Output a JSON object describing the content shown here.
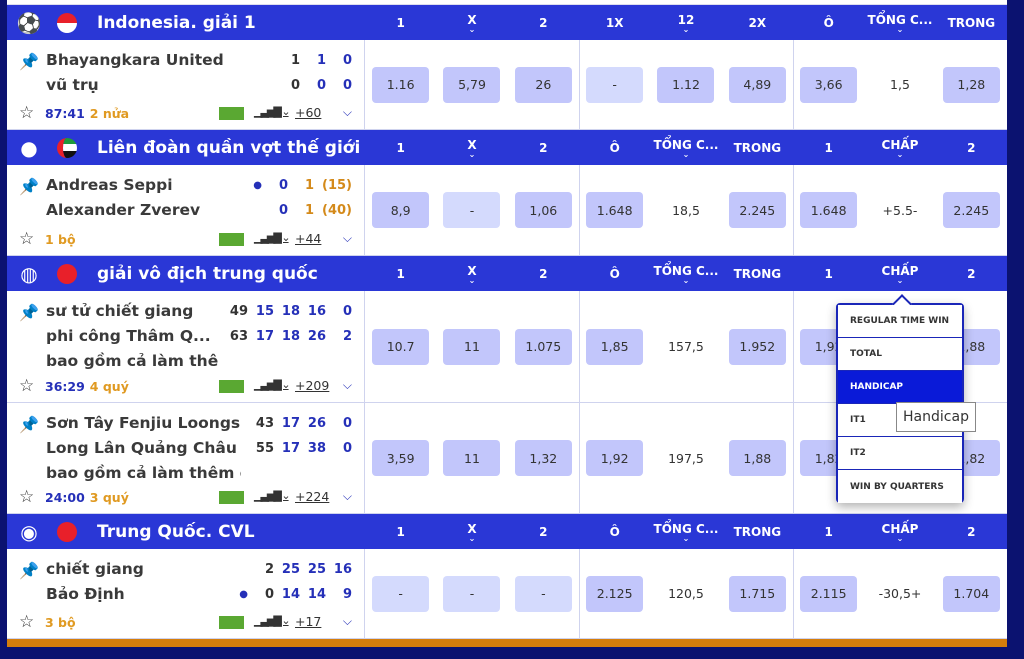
{
  "colors": {
    "header": "#2a37d6",
    "odd_bg": "#c2c6fb",
    "empty_bg": "#d4dafd",
    "accent_blue": "#2530b8",
    "period_orange": "#e09a22",
    "dropdown_selected": "#0a1ad8",
    "bottom_bar": "#d47d0c"
  },
  "leagues": [
    {
      "sport_icon": "soccer-ball-icon",
      "flag": "indonesia",
      "name": "Indonesia. giải 1",
      "columns": [
        {
          "label": "1"
        },
        {
          "label": "X",
          "chevron": true
        },
        {
          "label": "2"
        },
        {
          "label": "1X"
        },
        {
          "label": "12",
          "chevron": true
        },
        {
          "label": "2X"
        },
        {
          "label": "Ô"
        },
        {
          "label": "TỔNG C...",
          "chevron": true
        },
        {
          "label": "TRONG"
        }
      ],
      "matches": [
        {
          "teams": [
            "Bhayangkara United",
            "vũ trụ"
          ],
          "scores": [
            [
              "1",
              "1",
              "0"
            ],
            [
              "0",
              "0",
              "0"
            ]
          ],
          "score_kinds": [
            "total",
            "period",
            "period"
          ],
          "time": "87:41",
          "period": "2 nửa",
          "more": "+60",
          "height": 90,
          "odds": [
            {
              "v": "1.16"
            },
            {
              "v": "5,79"
            },
            {
              "v": "26"
            },
            {
              "v": "-",
              "empty": true
            },
            {
              "v": "1.12"
            },
            {
              "v": "4,89"
            },
            {
              "v": "3,66"
            },
            {
              "v": "1,5",
              "plain": true
            },
            {
              "v": "1,28"
            }
          ]
        }
      ]
    },
    {
      "sport_icon": "tennis-ball-icon",
      "flag": "uae",
      "name": "Liên đoàn quần vợt thế giới",
      "columns": [
        {
          "label": "1"
        },
        {
          "label": "X",
          "chevron": true
        },
        {
          "label": "2"
        },
        {
          "label": "Ô"
        },
        {
          "label": "TỔNG C...",
          "chevron": true
        },
        {
          "label": "TRONG"
        },
        {
          "label": "1"
        },
        {
          "label": "CHẤP",
          "chevron": true
        },
        {
          "label": "2"
        }
      ],
      "matches": [
        {
          "teams": [
            "Andreas Seppi",
            "Alexander Zverev"
          ],
          "scores": [
            [
              "0",
              "1",
              "(15)"
            ],
            [
              "0",
              "1",
              "(40)"
            ]
          ],
          "score_kinds": [
            "period",
            "game",
            "game"
          ],
          "serve_row": 0,
          "serve_icon": "tennis-serve-icon",
          "time": "",
          "period": "1 bộ",
          "more": "+44",
          "height": 91,
          "odds": [
            {
              "v": "8,9"
            },
            {
              "v": "-",
              "empty": true
            },
            {
              "v": "1,06"
            },
            {
              "v": "1.648"
            },
            {
              "v": "18,5",
              "plain": true
            },
            {
              "v": "2.245"
            },
            {
              "v": "1.648"
            },
            {
              "v": "+5.5-",
              "plain": true
            },
            {
              "v": "2.245"
            }
          ]
        }
      ]
    },
    {
      "sport_icon": "basketball-icon",
      "flag": "china",
      "name": "giải vô địch trung quốc",
      "columns": [
        {
          "label": "1"
        },
        {
          "label": "X",
          "chevron": true
        },
        {
          "label": "2"
        },
        {
          "label": "Ô"
        },
        {
          "label": "TỔNG C...",
          "chevron": true
        },
        {
          "label": "TRONG"
        },
        {
          "label": "1"
        },
        {
          "label": "CHẤP",
          "chevron": true
        },
        {
          "label": "2"
        }
      ],
      "matches": [
        {
          "teams": [
            "sư tử chiết giang",
            "phi công Thâm Q...",
            "bao gồm cả làm thê"
          ],
          "scores": [
            [
              "49",
              "15",
              "18",
              "16",
              "0"
            ],
            [
              "63",
              "17",
              "18",
              "26",
              "2"
            ]
          ],
          "score_kinds": [
            "total",
            "period",
            "period",
            "period",
            "period"
          ],
          "time": "36:29",
          "period": "4 quý",
          "more": "+209",
          "height": 112,
          "odds": [
            {
              "v": "10.7"
            },
            {
              "v": "11"
            },
            {
              "v": "1.075"
            },
            {
              "v": "1,85"
            },
            {
              "v": "157,5",
              "plain": true
            },
            {
              "v": "1.952"
            },
            {
              "v": "1,92"
            },
            {
              "v": "",
              "plain": true
            },
            {
              "v": "1,88"
            }
          ]
        },
        {
          "teams": [
            "Sơn Tây Fenjiu Loongs",
            "Long Lân Quảng Châu",
            "bao gồm cả làm thêm g"
          ],
          "scores": [
            [
              "43",
              "17",
              "26",
              "0"
            ],
            [
              "55",
              "17",
              "38",
              "0"
            ]
          ],
          "score_kinds": [
            "total",
            "period",
            "period",
            "period"
          ],
          "time": "24:00",
          "period": "3 quý",
          "more": "+224",
          "height": 111,
          "odds": [
            {
              "v": "3,59"
            },
            {
              "v": "11"
            },
            {
              "v": "1,32"
            },
            {
              "v": "1,92"
            },
            {
              "v": "197,5",
              "plain": true
            },
            {
              "v": "1,88"
            },
            {
              "v": "1,82"
            },
            {
              "v": "",
              "plain": true
            },
            {
              "v": "1,82"
            }
          ]
        }
      ]
    },
    {
      "sport_icon": "volleyball-icon",
      "flag": "china",
      "name": "Trung Quốc. CVL",
      "columns": [
        {
          "label": "1"
        },
        {
          "label": "X",
          "chevron": true
        },
        {
          "label": "2"
        },
        {
          "label": "Ô"
        },
        {
          "label": "TỔNG C...",
          "chevron": true
        },
        {
          "label": "TRONG"
        },
        {
          "label": "1"
        },
        {
          "label": "CHẤP",
          "chevron": true
        },
        {
          "label": "2"
        }
      ],
      "matches": [
        {
          "teams": [
            "chiết giang",
            "Bảo Định"
          ],
          "scores": [
            [
              "2",
              "25",
              "25",
              "16"
            ],
            [
              "0",
              "14",
              "14",
              "9"
            ]
          ],
          "score_kinds": [
            "total",
            "period",
            "period",
            "period"
          ],
          "serve_row": 1,
          "serve_icon": "volleyball-serve-icon",
          "time": "",
          "period": "3 bộ",
          "more": "+17",
          "height": 90,
          "odds": [
            {
              "v": "-",
              "empty": true
            },
            {
              "v": "-",
              "empty": true
            },
            {
              "v": "-",
              "empty": true
            },
            {
              "v": "2.125"
            },
            {
              "v": "120,5",
              "plain": true
            },
            {
              "v": "1.715"
            },
            {
              "v": "2.115"
            },
            {
              "v": "-30,5+",
              "plain": true
            },
            {
              "v": "1.704"
            }
          ]
        }
      ]
    }
  ],
  "dropdown": {
    "items": [
      "REGULAR TIME WIN",
      "TOTAL",
      "HANDICAP",
      "IT1",
      "IT2",
      "WIN BY QUARTERS"
    ],
    "selected": "HANDICAP"
  },
  "tooltip": "Handicap"
}
